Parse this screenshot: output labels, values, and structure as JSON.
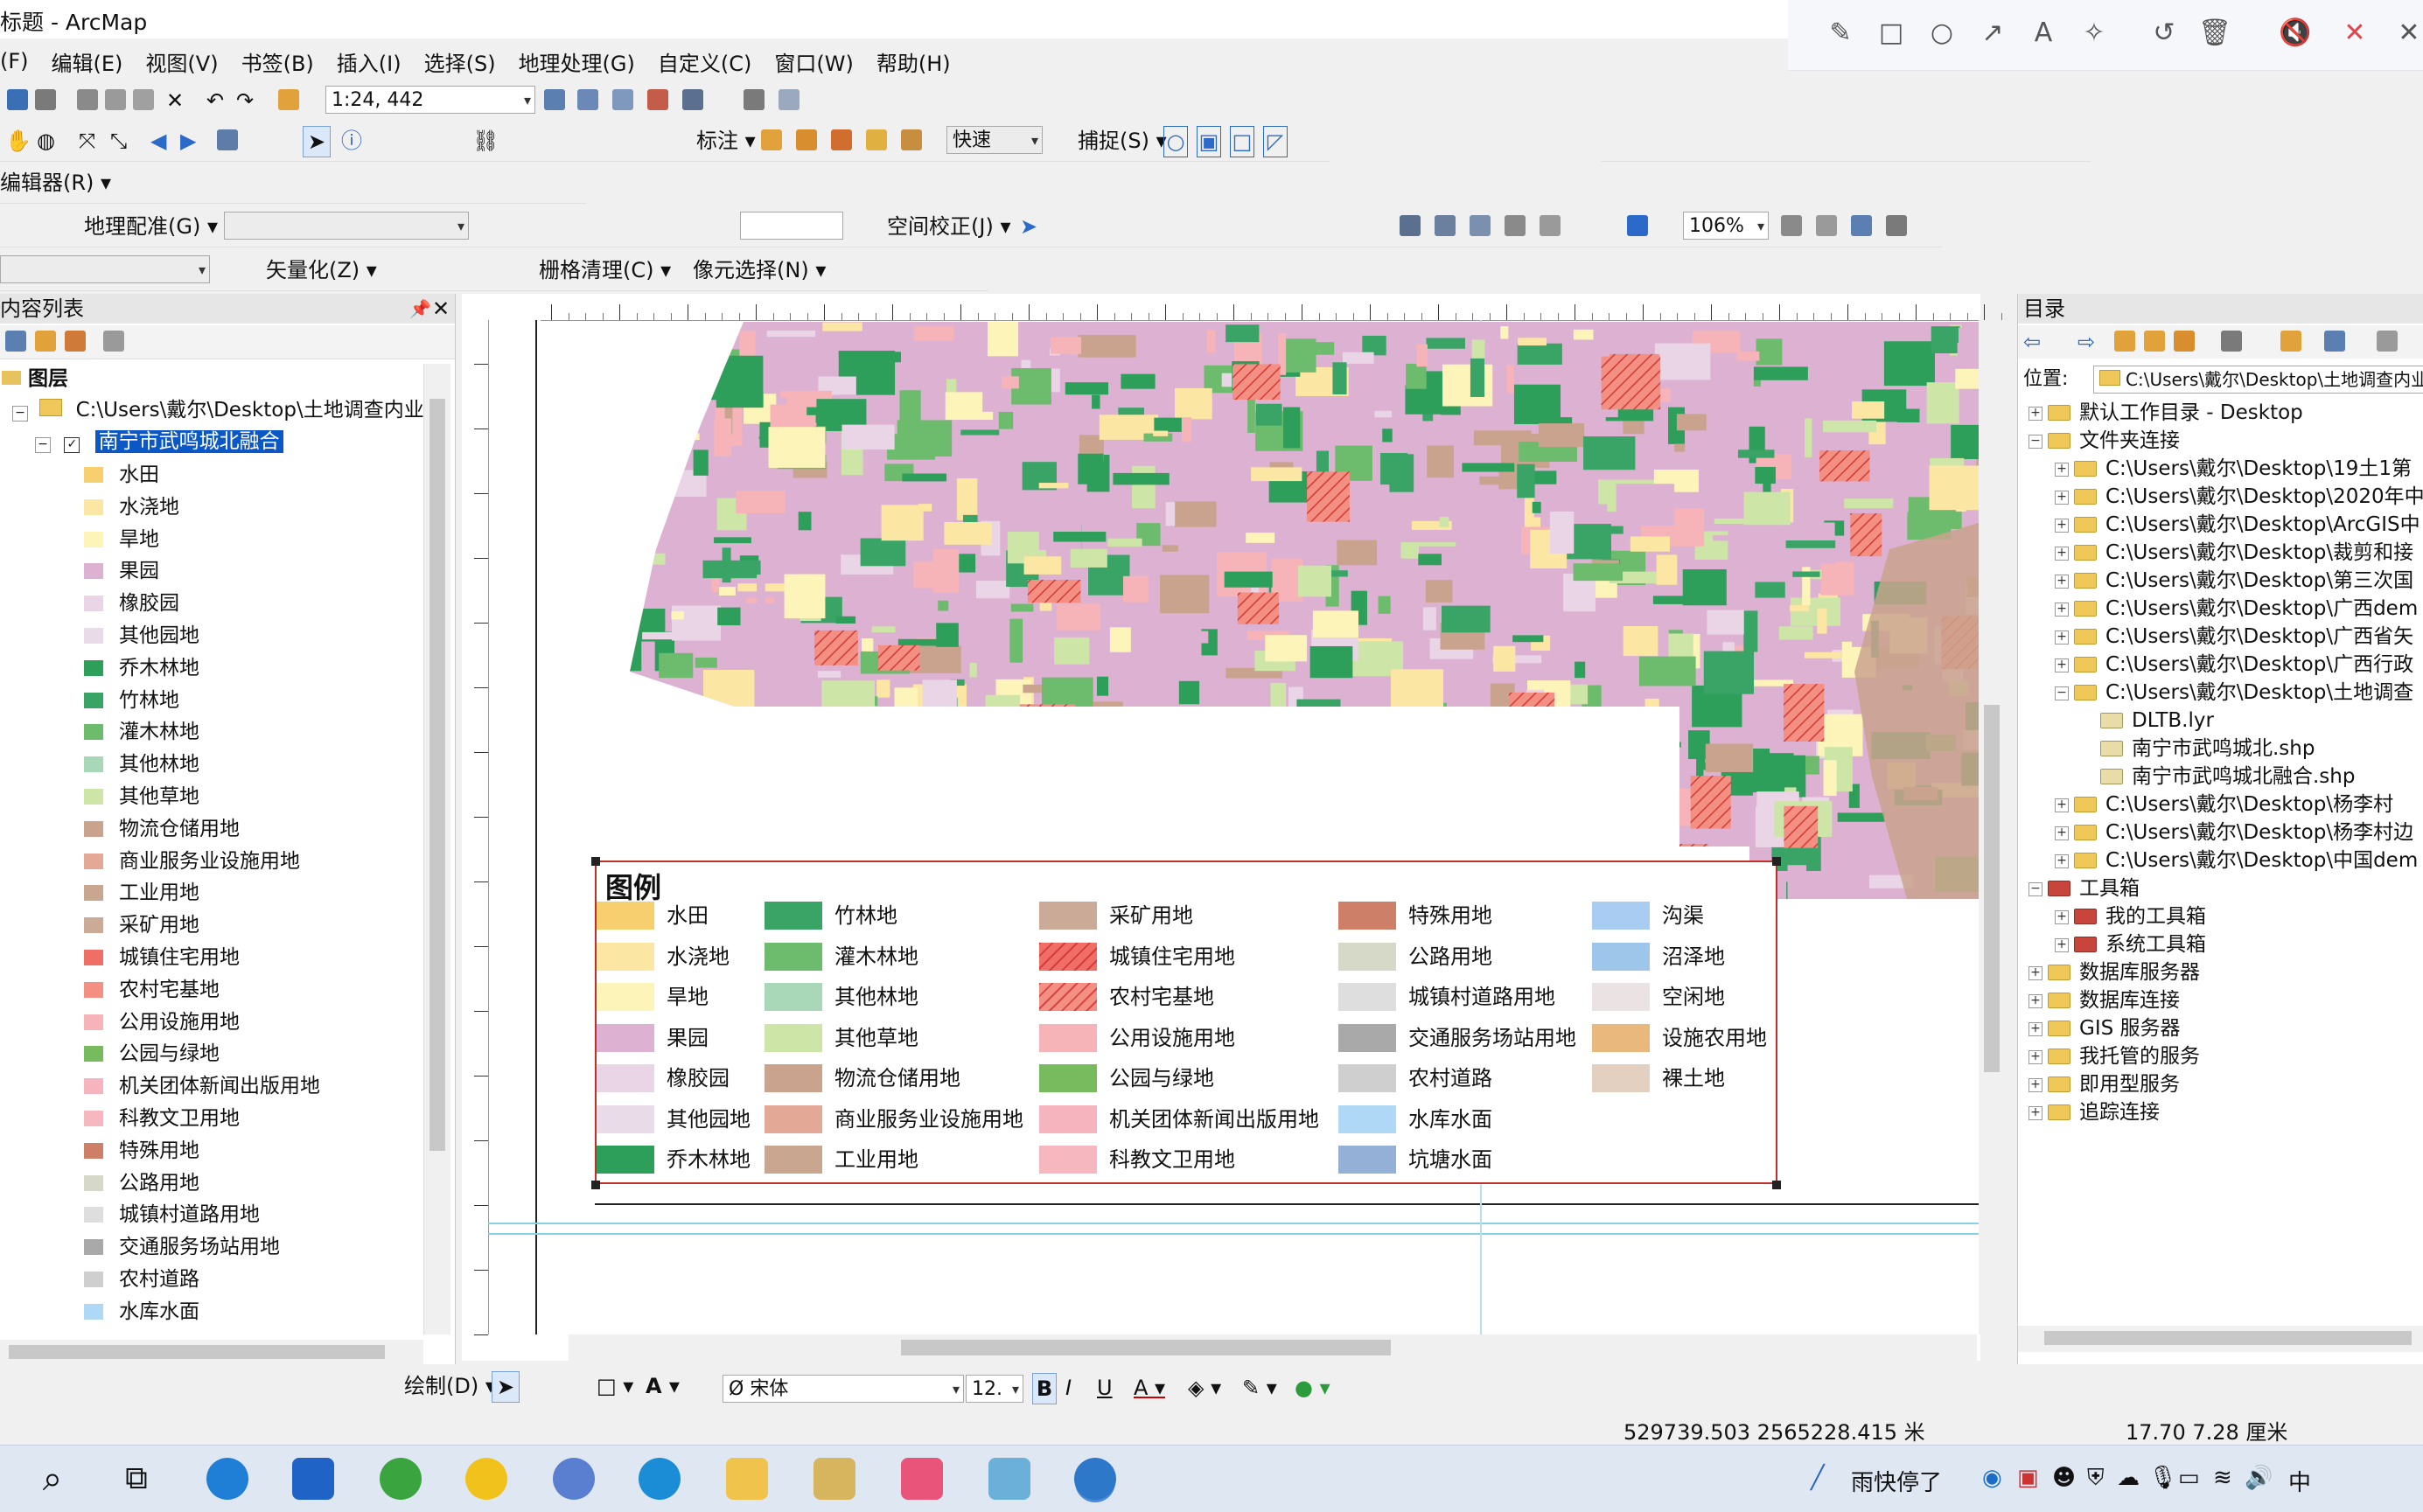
{
  "window": {
    "title": "标题 - ArcMap"
  },
  "menu": [
    "(F)",
    "编辑(E)",
    "视图(V)",
    "书签(B)",
    "插入(I)",
    "选择(S)",
    "地理处理(G)",
    "自定义(C)",
    "窗口(W)",
    "帮助(H)"
  ],
  "toolbars": {
    "scale": "1:24, 442",
    "label_menu": "标注",
    "fast": "快速",
    "snap_menu": "捕捉(S)",
    "editor_menu": "编辑器(R)",
    "georef_menu": "地理配准(G)",
    "spatial_adjust_menu": "空间校正(J)",
    "zoom": "106%",
    "vectorize_menu": "矢量化(Z)",
    "raster_cleanup_menu": "栅格清理(C)",
    "cell_select_menu": "像元选择(N)"
  },
  "toc": {
    "title": "内容列表",
    "root": "图层",
    "path": "C:\\Users\\戴尔\\Desktop\\土地调查内业",
    "layer": "南宁市武鸣城北融合",
    "classes": [
      {
        "label": "水田",
        "color": "#f7cf6e"
      },
      {
        "label": "水浇地",
        "color": "#fbe7a3"
      },
      {
        "label": "旱地",
        "color": "#fdf4b9"
      },
      {
        "label": "果园",
        "color": "#dcb1d2"
      },
      {
        "label": "橡胶园",
        "color": "#ead5e7"
      },
      {
        "label": "其他园地",
        "color": "#eadbe8"
      },
      {
        "label": "乔木林地",
        "color": "#2e9e5b"
      },
      {
        "label": "竹林地",
        "color": "#3aa466"
      },
      {
        "label": "灌木林地",
        "color": "#6dbb6d"
      },
      {
        "label": "其他林地",
        "color": "#a8d8b8"
      },
      {
        "label": "其他草地",
        "color": "#cde6a8"
      },
      {
        "label": "物流仓储用地",
        "color": "#caa38e"
      },
      {
        "label": "商业服务业设施用地",
        "color": "#e3a996"
      },
      {
        "label": "工业用地",
        "color": "#c9a68f"
      },
      {
        "label": "采矿用地",
        "color": "#ccaa98"
      },
      {
        "label": "城镇住宅用地",
        "color": "#ef6e66"
      },
      {
        "label": "农村宅基地",
        "color": "#f48f84"
      },
      {
        "label": "公用设施用地",
        "color": "#f6b4b8"
      },
      {
        "label": "公园与绿地",
        "color": "#77bb5e"
      },
      {
        "label": "机关团体新闻出版用地",
        "color": "#f5b4be"
      },
      {
        "label": "科教文卫用地",
        "color": "#f6b7bf"
      },
      {
        "label": "特殊用地",
        "color": "#cd7f67"
      },
      {
        "label": "公路用地",
        "color": "#d7d9c8"
      },
      {
        "label": "城镇村道路用地",
        "color": "#dedede"
      },
      {
        "label": "交通服务场站用地",
        "color": "#a9a9a9"
      },
      {
        "label": "农村道路",
        "color": "#cfcfcf"
      },
      {
        "label": "水库水面",
        "color": "#aed8f5"
      }
    ]
  },
  "legend": {
    "title": "图例",
    "items": [
      {
        "label": "水田",
        "color": "#f7cf6e"
      },
      {
        "label": "水浇地",
        "color": "#fbe7a3"
      },
      {
        "label": "旱地",
        "color": "#fdf4b9"
      },
      {
        "label": "果园",
        "color": "#dcb1d2"
      },
      {
        "label": "橡胶园",
        "color": "#ead5e7"
      },
      {
        "label": "其他园地",
        "color": "#eadbe8"
      },
      {
        "label": "乔木林地",
        "color": "#2e9e5b"
      },
      {
        "label": "竹林地",
        "color": "#3aa466"
      },
      {
        "label": "灌木林地",
        "color": "#6dbb6d"
      },
      {
        "label": "其他林地",
        "color": "#a8d8b8"
      },
      {
        "label": "其他草地",
        "color": "#cde6a8"
      },
      {
        "label": "物流仓储用地",
        "color": "#caa38e"
      },
      {
        "label": "商业服务业设施用地",
        "color": "#e3a996"
      },
      {
        "label": "工业用地",
        "color": "#c9a68f"
      },
      {
        "label": "采矿用地",
        "color": "#ccaa98"
      },
      {
        "label": "城镇住宅用地",
        "color": "#ef6e66"
      },
      {
        "label": "农村宅基地",
        "color": "#f48f84"
      },
      {
        "label": "公用设施用地",
        "color": "#f6b4b8"
      },
      {
        "label": "公园与绿地",
        "color": "#77bb5e"
      },
      {
        "label": "机关团体新闻出版用地",
        "color": "#f5b4be"
      },
      {
        "label": "科教文卫用地",
        "color": "#f6b7bf"
      },
      {
        "label": "特殊用地",
        "color": "#cd7f67"
      },
      {
        "label": "公路用地",
        "color": "#d7d9c8"
      },
      {
        "label": "城镇村道路用地",
        "color": "#dedede"
      },
      {
        "label": "交通服务场站用地",
        "color": "#a9a9a9"
      },
      {
        "label": "农村道路",
        "color": "#cfcfcf"
      },
      {
        "label": "水库水面",
        "color": "#aed8f5"
      },
      {
        "label": "坑塘水面",
        "color": "#95b0d6"
      },
      {
        "label": "沟渠",
        "color": "#a9cdf2"
      },
      {
        "label": "沼泽地",
        "color": "#9ec5ea"
      },
      {
        "label": "空闲地",
        "color": "#ebe2e4"
      },
      {
        "label": "设施农用地",
        "color": "#e8b87c"
      },
      {
        "label": "裸土地",
        "color": "#e3d0c0"
      }
    ]
  },
  "catalog": {
    "title": "目录",
    "location_label": "位置:",
    "location_value": "C:\\Users\\戴尔\\Desktop\\土地调查内业",
    "items": [
      "默认工作目录 - Desktop",
      "文件夹连接",
      "C:\\Users\\戴尔\\Desktop\\19土1第",
      "C:\\Users\\戴尔\\Desktop\\2020年中",
      "C:\\Users\\戴尔\\Desktop\\ArcGIS中",
      "C:\\Users\\戴尔\\Desktop\\裁剪和接",
      "C:\\Users\\戴尔\\Desktop\\第三次国",
      "C:\\Users\\戴尔\\Desktop\\广西dem",
      "C:\\Users\\戴尔\\Desktop\\广西省矢",
      "C:\\Users\\戴尔\\Desktop\\广西行政",
      "C:\\Users\\戴尔\\Desktop\\土地调查",
      "DLTB.lyr",
      "南宁市武鸣城北.shp",
      "南宁市武鸣城北融合.shp",
      "C:\\Users\\戴尔\\Desktop\\杨李村",
      "C:\\Users\\戴尔\\Desktop\\杨李村边",
      "C:\\Users\\戴尔\\Desktop\\中国dem",
      "工具箱",
      "我的工具箱",
      "系统工具箱",
      "数据库服务器",
      "数据库连接",
      "GIS 服务器",
      "我托管的服务",
      "即用型服务",
      "追踪连接"
    ]
  },
  "drawbar": {
    "draw_menu": "绘制(D)",
    "font": "宋体",
    "size": "12."
  },
  "status": {
    "coords": "529739.503  2565228.415 米",
    "page_coords": "17.70  7.28 厘米"
  },
  "taskbar": {
    "weather": "雨快停了",
    "ime": "中"
  }
}
